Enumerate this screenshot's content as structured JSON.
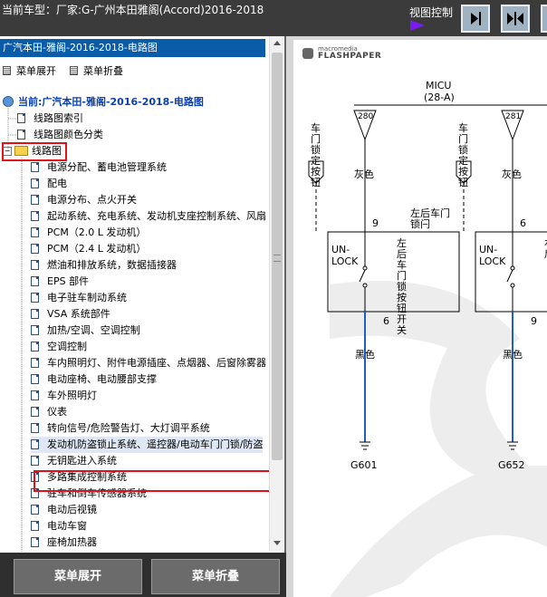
{
  "titlebar": {
    "title": "当前车型：厂家:G-广州本田雅阁(Accord)2016-2018",
    "view_control_label": "视图控制"
  },
  "left_panel": {
    "header": "广汽本田-雅阁-2016-2018-电路图",
    "toolbar": {
      "expand_label": "菜单展开",
      "collapse_label": "菜单折叠"
    },
    "tree": {
      "root_label": "当前:广汽本田-雅阁-2016-2018-电路图",
      "top_items": [
        "线路图索引",
        "线路图颜色分类"
      ],
      "folder_label": "线路图",
      "items": [
        "电源分配、蓄电池管理系统",
        "配电",
        "电源分布、点火开关",
        "起动系统、充电系统、发动机支座控制系统、风扇",
        "PCM（2.0 L 发动机）",
        "PCM（2.4 L 发动机）",
        "燃油和排放系统，数据插接器",
        "EPS 部件",
        "电子驻车制动系统",
        "VSA 系统部件",
        "加热/空调、空调控制",
        "空调控制",
        "车内照明灯、附件电源插座、点烟器、后窗除雾器",
        "电动座椅、电动腰部支撑",
        "车外照明灯",
        "仪表",
        "转向信号/危险警告灯、大灯调平系统",
        "发动机防盗锁止系统、遥控器/电动车门门锁/防盗",
        "无钥匙进入系统",
        "多路集成控制系统",
        "驻车和倒车传感器系统",
        "电动后视镜",
        "电动车窗",
        "座椅加热器"
      ]
    }
  },
  "bottom_buttons": {
    "expand_label": "菜单展开",
    "collapse_label": "菜单折叠"
  },
  "document": {
    "logo_line1": "macromedia",
    "logo_line2": "FLASHPAPER",
    "micu_label": "MICU",
    "micu_connector": "(28-A)",
    "left_circuit": {
      "pin_top": "280",
      "switch_name": "车门锁定按钮",
      "wire_color_top": "灰色",
      "pin_9": "9",
      "door_lock_label": "左后车门锁闩",
      "unlock_label": "UN-LOCK",
      "switch_vertical_label": "左后车门锁按钮开关",
      "pin_6": "6",
      "wire_color_bottom": "黑色",
      "ground": "G601"
    },
    "right_circuit": {
      "pin_top": "281",
      "switch_name": "车门锁定按钮",
      "wire_color_top": "灰色",
      "pin_6": "6",
      "unlock_label": "UN-LOCK",
      "switch_vertical_label": "右后",
      "pin_9": "9",
      "wire_color_bottom": "黑色",
      "ground": "G652"
    },
    "colors": {
      "wire_blue": "#1f5fbf",
      "highlight_red": "#e3101a",
      "header_blue": "#0b5ca8"
    }
  }
}
